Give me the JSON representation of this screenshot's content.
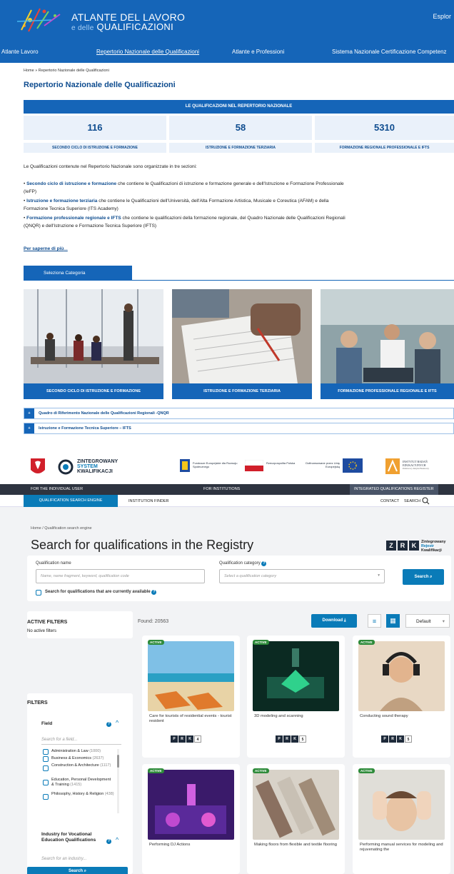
{
  "atlante": {
    "logo_line1": "ATLANTE DEL LAVORO",
    "logo_line2_prefix": "e delle",
    "logo_line2": "QUALIFICAZIONI",
    "explore": "Esplor",
    "nav": [
      "Atlante Lavoro",
      "Repertorio Nazionale delle Qualificazioni",
      "Atlante e Professioni",
      "Sistema Nazionale Certificazione Competenz"
    ],
    "breadcrumb": "Home » Repertorio Nazionale delle Qualificazioni",
    "title": "Repertorio Nazionale delle Qualificazioni",
    "bar_title": "LE QUALIFICAZIONI NEL REPERTORIO NAZIONALE",
    "stats": [
      {
        "value": "116",
        "label": "SECONDO CICLO DI ISTRUZIONE E FORMAZIONE"
      },
      {
        "value": "58",
        "label": "ISTRUZIONE E FORMAZIONE TERZIARIA"
      },
      {
        "value": "5310",
        "label": "FORMAZIONE REGIONALE PROFESSIONALE E IFTS"
      }
    ],
    "intro": "Le Qualificazioni contenute nel Repertorio Nazionale sono organizzate in tre sezioni:",
    "bullets": [
      {
        "bold": "Secondo ciclo di istruzione e formazione",
        "text": "che contiene le Qualificazioni di istruzione e formazione generale e dell'Istruzione e Formazione Professionale",
        "text2": "(IeFP)"
      },
      {
        "bold": "Istruzione e formazione terziaria",
        "text": "che contiene le Qualificazioni dell'Università, dell'Alta Formazione Artistica, Musicale e Coreutica (AFAM) e della",
        "text2": "Formazione Tecnica Superiore (ITS Academy)"
      },
      {
        "bold": "Formazione professionale regionale e IFTS",
        "text": "che contiene le qualificazioni della formazione regionale, del Quadro Nazionale delle Qualificazioni Regionali",
        "text2": "(QNQR) e dell'Istruzione e Formazione Tecnica Superiore (IFTS)"
      }
    ],
    "more_link": "Per saperne di più",
    "more_suffix": "...",
    "tab": "Seleziona Categoria",
    "categories": [
      "SECONDO CICLO DI ISTRUZIONE E FORMAZIONE",
      "ISTRUZIONE E FORMAZIONE TERZIARIA",
      "FORMAZIONE PROFESSIONALE REGIONALE E IFTS"
    ],
    "accordions": [
      "Quadro di Riferimento Nazionale delle Qualificazioni Regionali -QNQR",
      "Istruzione e Formazione Tecnica Superiore – IFTS"
    ],
    "colors": {
      "primary": "#1565b8",
      "dark": "#0e4c8f"
    }
  },
  "zsk": {
    "logo_l1": "ZINTEGROWANY",
    "logo_l2": "SYSTEM",
    "logo_l3": "KWALIFIKACJI",
    "eu1": "Fundusze Europejskie dla Rozwoju Społecznego",
    "eu2": "Rzeczpospolita Polska",
    "eu3": "Dofinansowane przez Unię Europejską",
    "ibe": "INSTYTUT BADAŃ EDUKACYJNYCH",
    "ibe_sub": "Państwowy Instytut Badawczy",
    "top_nav": [
      "FOR THE INDIVIDUAL USER",
      "FOR INSTITUTIONS",
      "INTEGRATED QUALIFICATIONS REGISTER"
    ],
    "sub_nav": [
      "QUALIFICATION SEARCH ENGINE",
      "INSTITUTION FINDER"
    ],
    "contact": "CONTACT",
    "search": "SEARCH",
    "breadcrumb": "Home / Qualification search engine",
    "title": "Search for qualifications in the Registry",
    "zrk_letters": [
      "Z",
      "R",
      "K"
    ],
    "zrk_text": [
      "Zintegrowany",
      "Rejestr",
      "Kwalifikacji"
    ],
    "qname_label": "Qualification name",
    "qname_placeholder": "Name, name fragment, keyword, qualification code",
    "qcat_label": "Qualification category",
    "qcat_placeholder": "Select a qualification category",
    "search_btn": "Search",
    "available_label": "Search for qualifications that are currently available",
    "active_filters_title": "ACTIVE FILTERS",
    "no_filters": "No active filters",
    "found": "Found: 20563",
    "download": "Download",
    "sort": "Default",
    "filters_title": "FILTERS",
    "field_title": "Field",
    "field_placeholder": "Search for a field...",
    "field_items": [
      {
        "label": "Administration & Law",
        "count": "(1000)"
      },
      {
        "label": "Business & Economics",
        "count": "(2637)"
      },
      {
        "label": "Construction & Architecture",
        "count": "(1117)"
      },
      {
        "label": "Education, Personal Development & Training",
        "count": "(1415)"
      },
      {
        "label": "Philosophy, History & Religion",
        "count": "(438)"
      }
    ],
    "industry_title": "Industry for Vocational Education Qualifications",
    "industry_placeholder": "Search for an industry...",
    "badge": "ACTIVE",
    "prk": [
      "P",
      "R",
      "K"
    ],
    "cards": [
      {
        "title": "Care for tourists of residential events - tourist resident",
        "level": "4"
      },
      {
        "title": "3D modeling and scanning",
        "level": "5"
      },
      {
        "title": "Conducting sound therapy",
        "level": "5"
      },
      {
        "title": "Performing DJ Actions",
        "level": ""
      },
      {
        "title": "Making floors from flexible and textile flooring",
        "level": ""
      },
      {
        "title": "Performing manual services for modeling and rejuvenating the",
        "level": ""
      }
    ],
    "colors": {
      "accent": "#0a7bb8",
      "dark": "#2e3440",
      "active": "#2e8b3a"
    }
  }
}
